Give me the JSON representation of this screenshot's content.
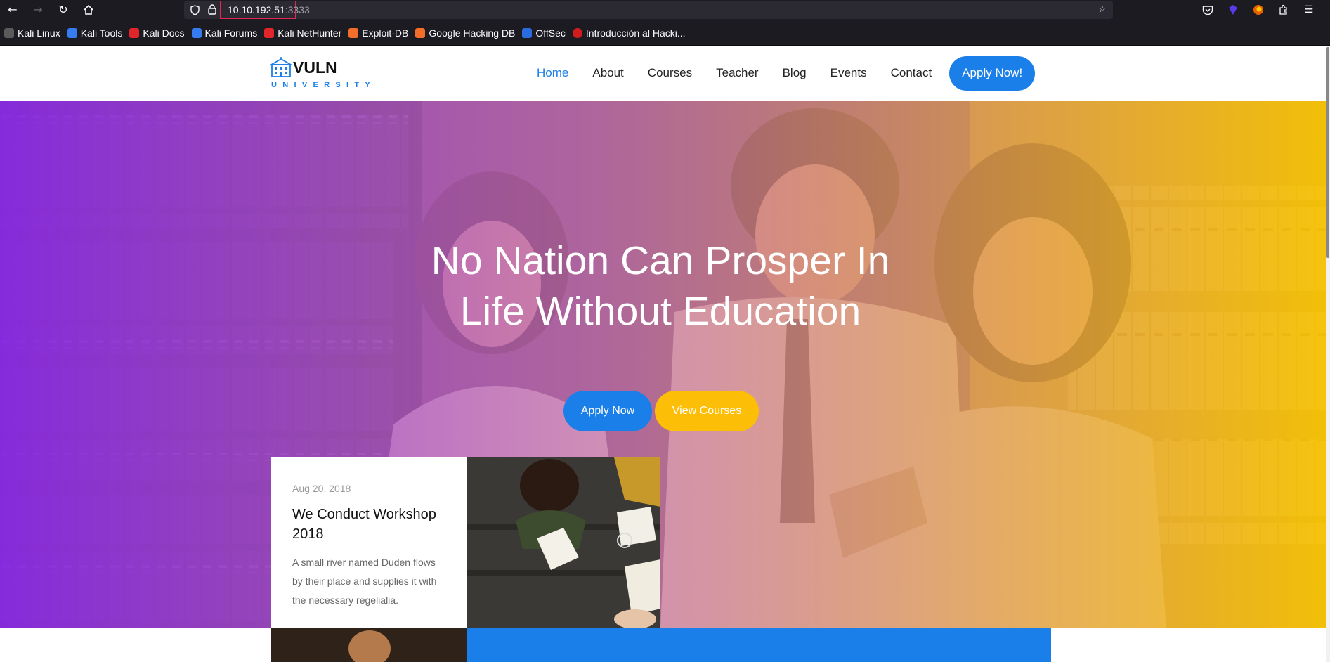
{
  "browser": {
    "url_host": "10.10.192.51",
    "url_port": ":3333",
    "nav_icons": [
      "back-icon",
      "forward-icon",
      "reload-icon",
      "home-icon"
    ],
    "right_icons": [
      "bookmark-star-icon",
      "pocket-icon",
      "extension-icon",
      "firefox-account-icon",
      "extensions-icon",
      "menu-icon"
    ],
    "bookmarks": [
      {
        "label": "Kali Linux",
        "color": "#5a5a5a"
      },
      {
        "label": "Kali Tools",
        "color": "#367bf0"
      },
      {
        "label": "Kali Docs",
        "color": "#e0252b"
      },
      {
        "label": "Kali Forums",
        "color": "#367bf0"
      },
      {
        "label": "Kali NetHunter",
        "color": "#e0252b"
      },
      {
        "label": "Exploit-DB",
        "color": "#f26e2a"
      },
      {
        "label": "Google Hacking DB",
        "color": "#f26e2a"
      },
      {
        "label": "OffSec",
        "color": "#2a6be0"
      },
      {
        "label": "Introducción al Hacki...",
        "color": "#d01c1c"
      }
    ]
  },
  "site": {
    "logo_title": "VULN",
    "logo_sub": "UNIVERSITY",
    "nav": [
      "Home",
      "About",
      "Courses",
      "Teacher",
      "Blog",
      "Events",
      "Contact"
    ],
    "active_nav": "Home",
    "apply_nav": "Apply Now!",
    "accent_blue": "#1a7fe8",
    "accent_yellow": "#fdbe07"
  },
  "hero": {
    "title_line1": "No Nation Can Prosper In",
    "title_line2": "Life Without Education",
    "apply_button": "Apply Now",
    "courses_button": "View Courses"
  },
  "event": {
    "date": "Aug 20, 2018",
    "title": "We Conduct Workshop 2018",
    "description": "A small river named Duden flows by their place and supplies it with the necessary regelialia."
  }
}
